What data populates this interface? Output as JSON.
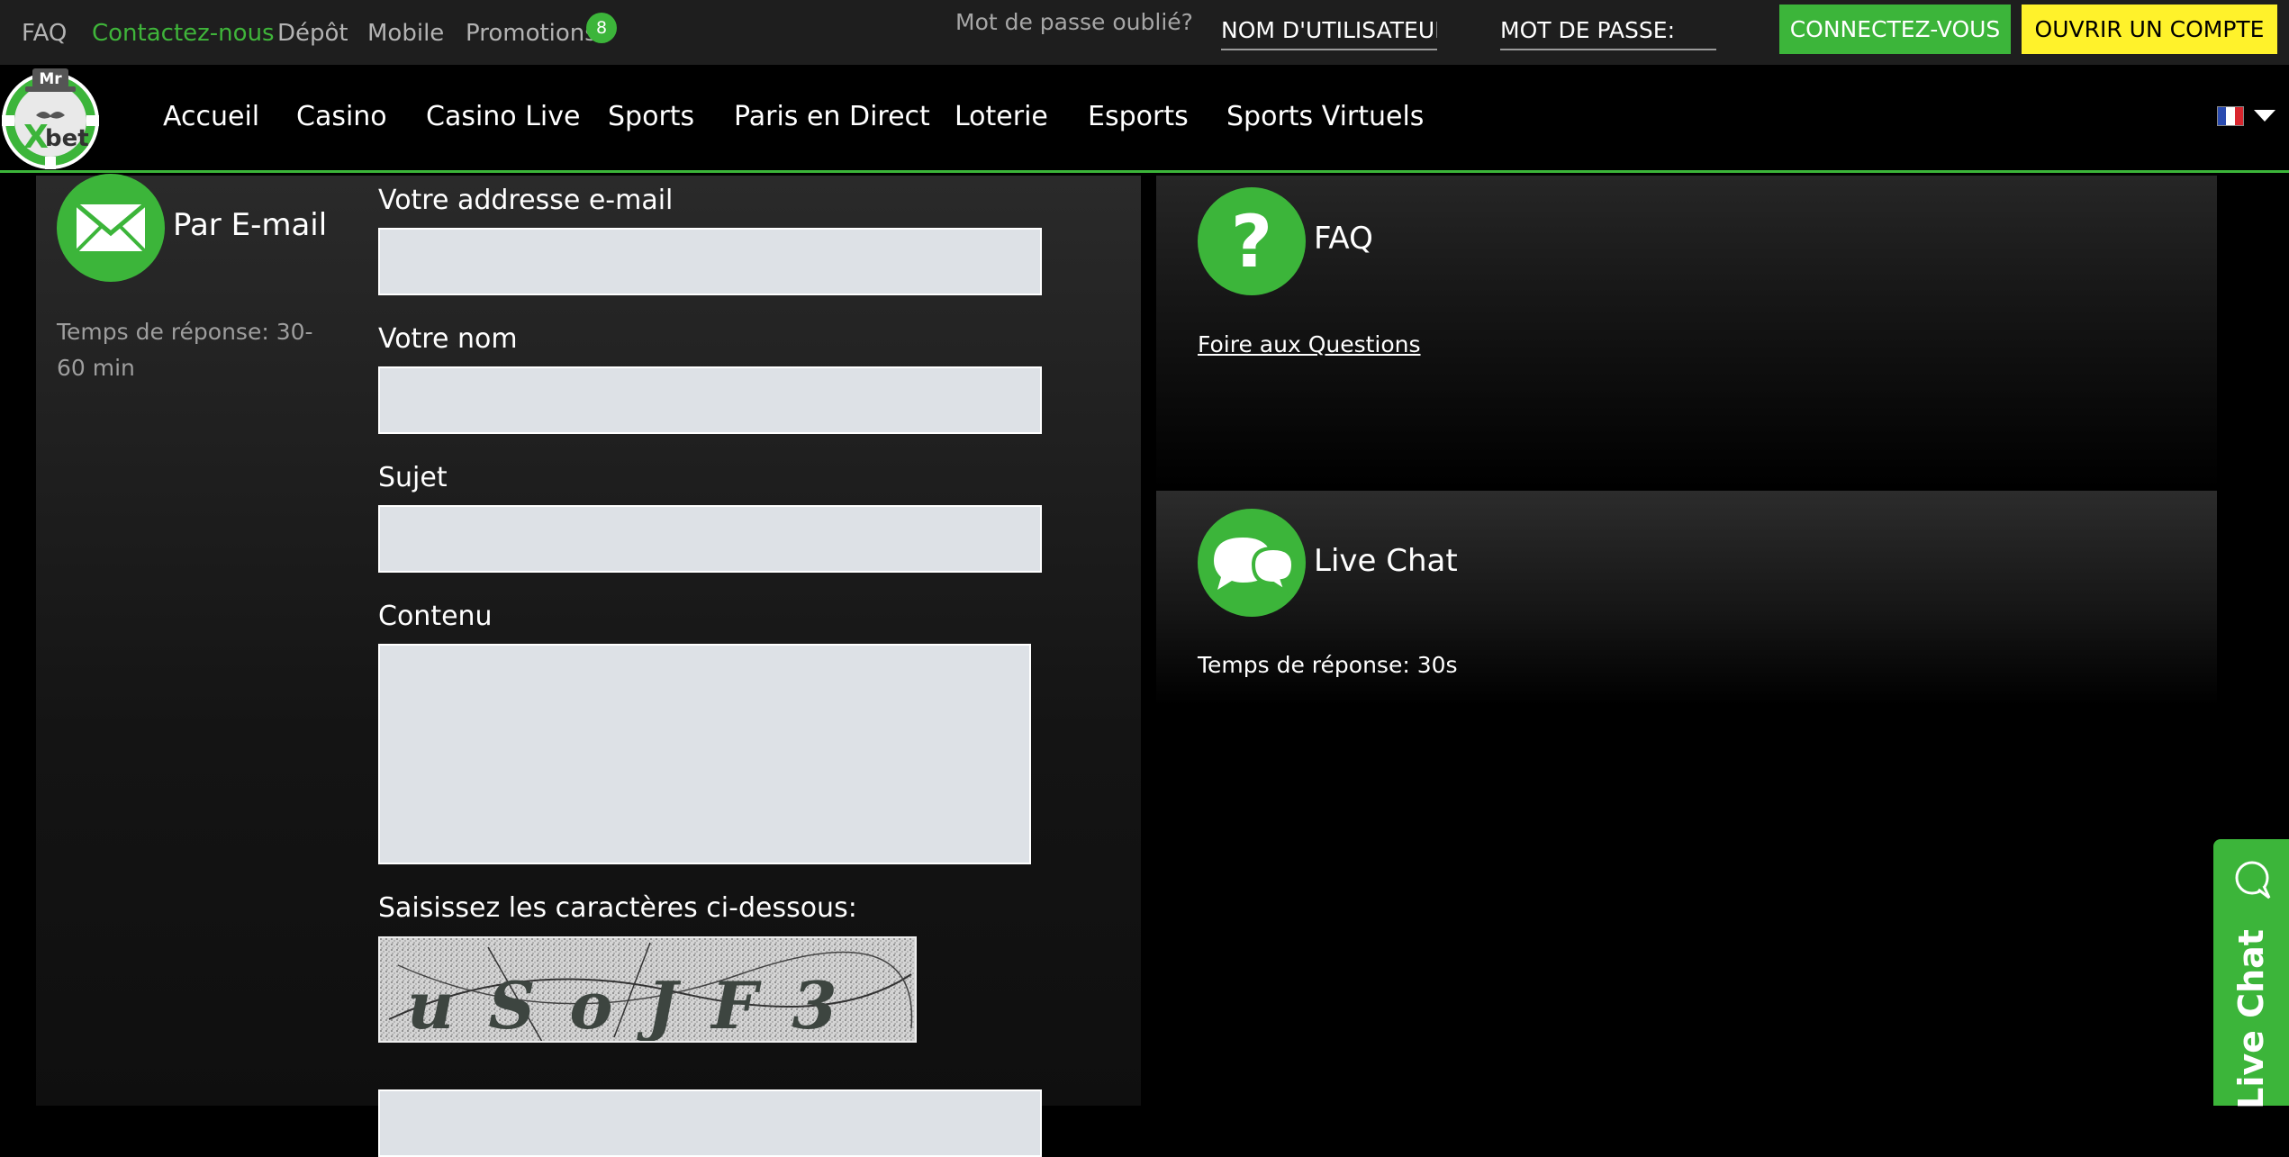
{
  "topbar": {
    "links": {
      "faq": "FAQ",
      "contact": "Contactez-nous",
      "deposit": "Dépôt",
      "mobile": "Mobile",
      "promotions": "Promotions"
    },
    "promotions_badge": "8",
    "forgot_password": "Mot de passe oublié?",
    "username_placeholder": "NOM D'UTILISATEUR",
    "password_placeholder": "MOT DE PASSE:",
    "login_button": "CONNECTEZ-VOUS",
    "register_button": "OUVRIR UN COMPTE"
  },
  "brand": {
    "logo_text_top": "Mr",
    "logo_text_x": "X",
    "logo_text_bet": "bet",
    "accent_color": "#3cb53a",
    "register_color": "#fff22b"
  },
  "nav": {
    "items": [
      "Accueil",
      "Casino",
      "Casino Live",
      "Sports",
      "Paris en Direct",
      "Loterie",
      "Esports",
      "Sports Virtuels"
    ],
    "language_icon": "flag-fr-icon"
  },
  "email_section": {
    "title": "Par E-mail",
    "response_time": "Temps de réponse: 30-60 min",
    "icon": "envelope-icon"
  },
  "form": {
    "email_label": "Votre addresse e-mail",
    "name_label": "Votre nom",
    "subject_label": "Sujet",
    "content_label": "Contenu",
    "captcha_label": "Saisissez les caractères ci-dessous:",
    "captcha_text": "uSoJF3",
    "email_value": "",
    "name_value": "",
    "subject_value": "",
    "content_value": ""
  },
  "faq_section": {
    "title": "FAQ",
    "link": "Foire aux Questions",
    "icon": "question-icon"
  },
  "chat_section": {
    "title": "Live Chat",
    "response_time": "Temps de réponse: 30s",
    "icon": "chat-bubbles-icon"
  },
  "livechat_tab": {
    "label": "Live Chat",
    "icon": "chat-bubble-icon"
  }
}
